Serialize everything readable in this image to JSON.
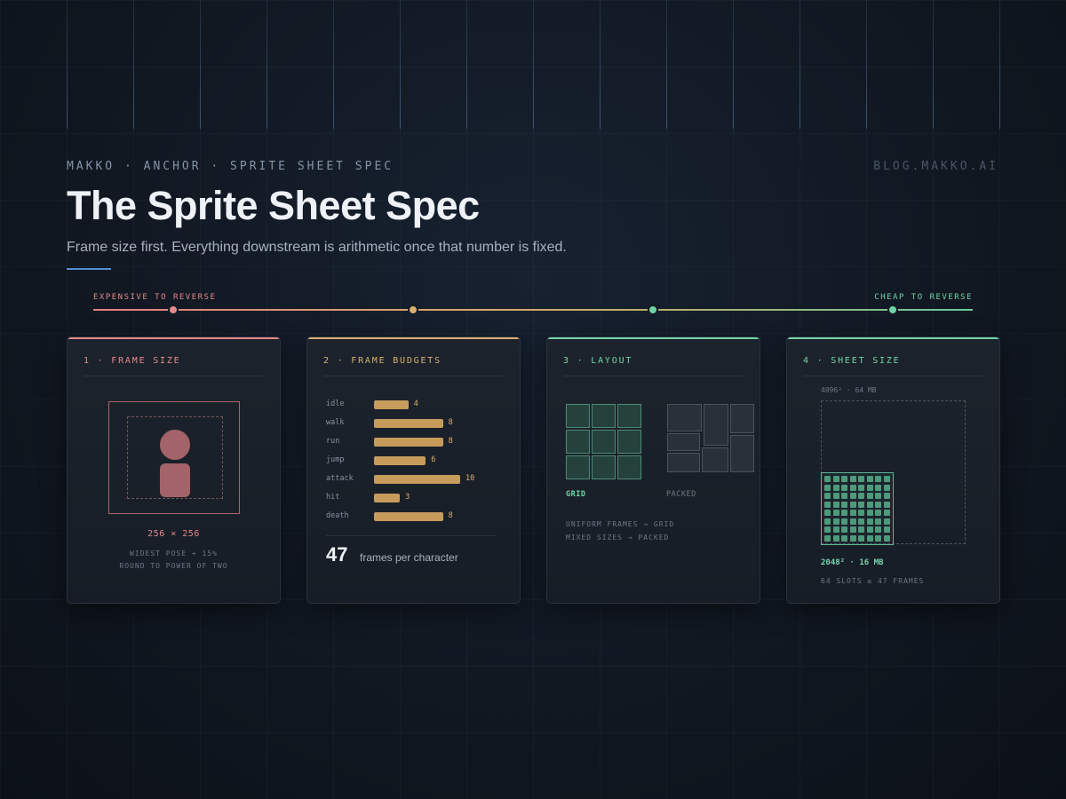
{
  "header": {
    "eyebrow": "MAKKO · ANCHOR · SPRITE SHEET SPEC",
    "site": "BLOG.MAKKO.AI",
    "title": "The Sprite Sheet Spec",
    "subtitle": "Frame size first. Everything downstream is arithmetic once that number is fixed."
  },
  "scale": {
    "left_label": "EXPENSIVE TO REVERSE",
    "right_label": "CHEAP TO REVERSE"
  },
  "colors": {
    "step1": "#e48a8a",
    "step2": "#d8b06f",
    "step3": "#6ed4a8",
    "step4": "#6ed4a8"
  },
  "cards": [
    {
      "title": "1 · FRAME SIZE",
      "dimension": "256 × 256",
      "note1": "WIDEST POSE + 15%",
      "note2": "ROUND TO POWER OF TWO"
    },
    {
      "title": "2 · FRAME BUDGETS",
      "budgets": [
        {
          "name": "idle",
          "frames": 4,
          "label": "4"
        },
        {
          "name": "walk",
          "frames": 8,
          "label": "8"
        },
        {
          "name": "run",
          "frames": 8,
          "label": "8"
        },
        {
          "name": "jump",
          "frames": 6,
          "label": "6"
        },
        {
          "name": "attack",
          "frames": 10,
          "label": "10"
        },
        {
          "name": "hit",
          "frames": 3,
          "label": "3"
        },
        {
          "name": "death",
          "frames": 8,
          "label": "8"
        }
      ],
      "total": "47",
      "total_label": "frames per character"
    },
    {
      "title": "3 · LAYOUT",
      "grid_label": "GRID",
      "packed_label": "PACKED",
      "note1": "UNIFORM FRAMES → GRID",
      "note2": "MIXED SIZES → PACKED"
    },
    {
      "title": "4 · SHEET SIZE",
      "big_label": "4096² · 64 MB",
      "small_label": "2048² · 16 MB",
      "slots_label": "64 SLOTS ≥ 47 FRAMES",
      "slots": 64
    }
  ]
}
